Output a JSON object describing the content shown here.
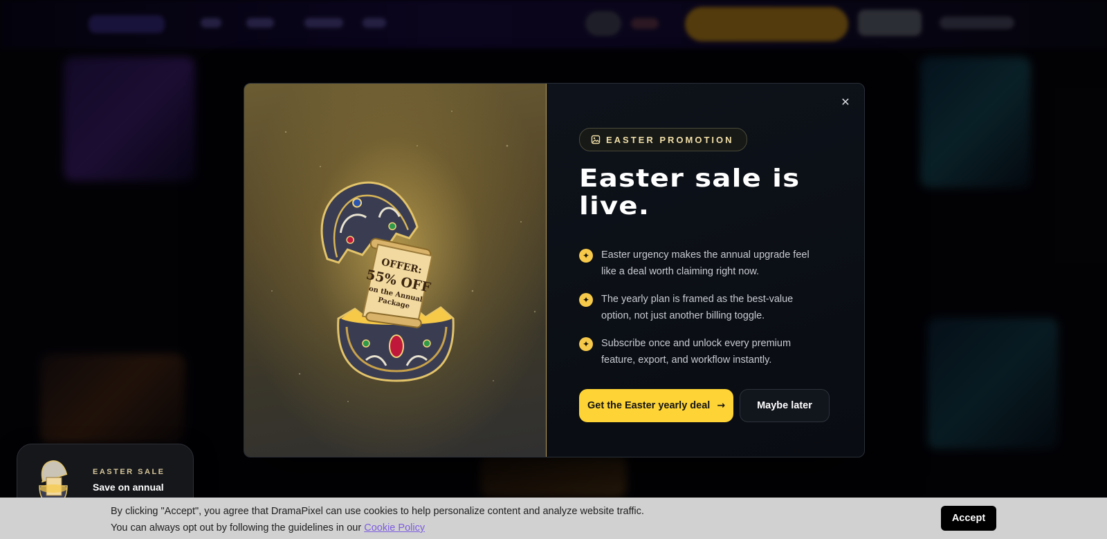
{
  "modal": {
    "close_icon": "close-icon",
    "badge_icon": "image-icon",
    "badge_label": "EASTER PROMOTION",
    "title": "Easter sale is live.",
    "features": [
      {
        "icon": "sparkles-icon",
        "text": "Easter urgency makes the annual upgrade feel like a deal worth claiming right now."
      },
      {
        "icon": "sparkles-icon",
        "text": "The yearly plan is framed as the best-value option, not just another billing toggle."
      },
      {
        "icon": "sparkles-icon",
        "text": "Subscribe once and unlock every premium feature, export, and workflow instantly."
      }
    ],
    "cta_label": "Get the Easter yearly deal",
    "cta_icon": "arrow-right-icon",
    "later_label": "Maybe later",
    "art": {
      "scroll_line1": "OFFER:",
      "scroll_line2": "55% OFF",
      "scroll_line3": "on the Annual",
      "scroll_line4": "Package"
    }
  },
  "mini_promo": {
    "kicker": "EASTER SALE",
    "title": "Save on annual"
  },
  "cookie": {
    "line1": "By clicking \"Accept\", you agree that DramaPixel can use cookies to help personalize content and analyze website traffic.",
    "line2_prefix": "You can always opt out by following the guidelines in our",
    "link_label": "Cookie Policy",
    "accept_label": "Accept"
  },
  "colors": {
    "accent_yellow": "#fdd335",
    "badge_text": "#f1dfa8",
    "link": "#7d5ce0"
  }
}
